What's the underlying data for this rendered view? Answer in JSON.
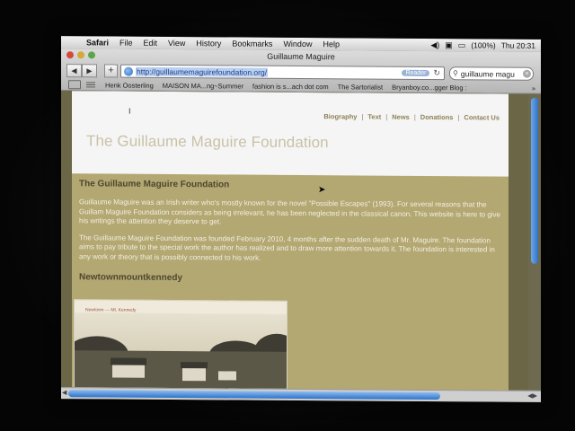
{
  "menubar": {
    "app": "Safari",
    "items": [
      "File",
      "Edit",
      "View",
      "History",
      "Bookmarks",
      "Window",
      "Help"
    ],
    "battery": "(100%)",
    "clock": "Thu 20:31"
  },
  "window": {
    "title": "Guillaume Maguire",
    "url": "http://guillaumemaguirefoundation.org/",
    "reader_label": "Reader",
    "search_value": "guillaume magu"
  },
  "bookmarks": [
    "Henk Oosterling",
    "MAISON MA...ng~Summer",
    "fashion is s...ach dot com",
    "The Sartorialist",
    "Bryanboy.co...gger Blog :"
  ],
  "site": {
    "nav": [
      "Biography",
      "Text",
      "News",
      "Donations",
      "Contact Us"
    ],
    "title": "The Guillaume Maguire Foundation",
    "heading": "The Guillaume Maguire Foundation",
    "para1": "Guillaume Maguire was an Irish writer who's mostly known for the novel \"Possible Escapes\" (1993). For several reasons that the Guillam Maguire Foundation considers as being irrelevant, he has been neglected in the classical canon. This website is here to give his writings the attention they deserve to get.",
    "para2": "The Guillaume Maguire Foundation was founded February 2010, 4 months after the sudden death of Mr. Maguire. The foundation aims to pay tribute to the special work the author has realized and to draw more attention towards it. The foundation is interested in any work or theory that is possibly connected to his work.",
    "subheading": "Newtownmountkennedy",
    "photo_caption": "Newtown — Mt. Kennedy"
  },
  "colors": {
    "page_bg": "#b3a772",
    "header_bg": "#f5f5f5",
    "accent_nav": "#8d8156",
    "heading": "#4d4830"
  }
}
